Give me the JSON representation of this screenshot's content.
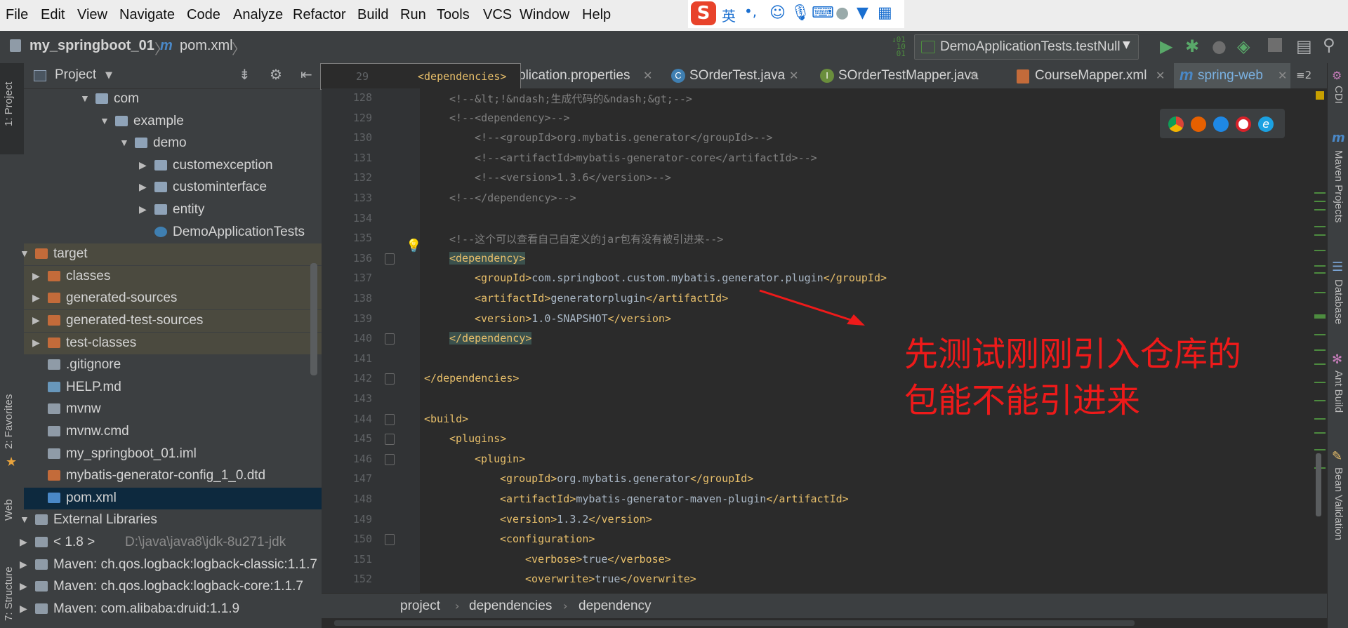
{
  "menu": [
    "File",
    "Edit",
    "View",
    "Navigate",
    "Code",
    "Analyze",
    "Refactor",
    "Build",
    "Run",
    "Tools",
    "VCS",
    "Window",
    "Help"
  ],
  "ime": {
    "logo": "S",
    "lang": "英",
    "punct": "•,"
  },
  "nav": {
    "project": "my_springboot_01",
    "file": "pom.xml",
    "run_config": "DemoApplicationTests.testNull"
  },
  "project_panel": {
    "title": "Project",
    "tree": [
      {
        "label": "com",
        "icon": "package",
        "arrow": "down"
      },
      {
        "label": "example",
        "icon": "package",
        "arrow": "down"
      },
      {
        "label": "demo",
        "icon": "package",
        "arrow": "down"
      },
      {
        "label": "customexception",
        "icon": "package",
        "arrow": "right"
      },
      {
        "label": "custominterface",
        "icon": "package",
        "arrow": "right"
      },
      {
        "label": "entity",
        "icon": "package",
        "arrow": "right"
      },
      {
        "label": "DemoApplicationTests",
        "icon": "class",
        "arrow": ""
      },
      {
        "label": "target",
        "icon": "folder-orange",
        "arrow": "down"
      },
      {
        "label": "classes",
        "icon": "folder-orange",
        "arrow": "right"
      },
      {
        "label": "generated-sources",
        "icon": "folder-orange",
        "arrow": "right"
      },
      {
        "label": "generated-test-sources",
        "icon": "folder-orange",
        "arrow": "right"
      },
      {
        "label": "test-classes",
        "icon": "folder-orange",
        "arrow": "right"
      },
      {
        "label": ".gitignore",
        "icon": "file",
        "arrow": ""
      },
      {
        "label": "HELP.md",
        "icon": "md",
        "arrow": ""
      },
      {
        "label": "mvnw",
        "icon": "file",
        "arrow": ""
      },
      {
        "label": "mvnw.cmd",
        "icon": "file",
        "arrow": ""
      },
      {
        "label": "my_springboot_01.iml",
        "icon": "file",
        "arrow": ""
      },
      {
        "label": "mybatis-generator-config_1_0.dtd",
        "icon": "dtd",
        "arrow": ""
      },
      {
        "label": "pom.xml",
        "icon": "maven",
        "arrow": ""
      },
      {
        "label": "External Libraries",
        "icon": "libs",
        "arrow": "down"
      },
      {
        "label": "< 1.8 >",
        "extra": "D:\\java\\java8\\jdk-8u271-jdk",
        "icon": "jdk",
        "arrow": "right"
      },
      {
        "label": "Maven: ch.qos.logback:logback-classic:1.1.7",
        "icon": "lib",
        "arrow": "right"
      },
      {
        "label": "Maven: ch.qos.logback:logback-core:1.1.7",
        "icon": "lib",
        "arrow": "right"
      },
      {
        "label": "Maven: com.alibaba:druid:1.1.9",
        "icon": "lib",
        "arrow": "right"
      }
    ]
  },
  "tabs": [
    {
      "label": "plication.properties"
    },
    {
      "label": "SOrderTest.java"
    },
    {
      "label": "SOrderTestMapper.java"
    },
    {
      "label": "CourseMapper.xml"
    },
    {
      "label": "spring-web",
      "active": true
    }
  ],
  "tab_overflow": "≡2",
  "pinned": {
    "line": "29",
    "text": "<dependencies>"
  },
  "code_lines": [
    {
      "n": "128",
      "parts": [
        [
          "cm",
          "<!--&lt;!&ndash;生成代码的&ndash;&gt;-->"
        ]
      ],
      "indent": 1
    },
    {
      "n": "129",
      "parts": [
        [
          "cm",
          "<!--<dependency>-->"
        ]
      ],
      "indent": 1
    },
    {
      "n": "130",
      "parts": [
        [
          "cm",
          "<!--<groupId>org.mybatis.generator</groupId>-->"
        ]
      ],
      "indent": 2
    },
    {
      "n": "131",
      "parts": [
        [
          "cm",
          "<!--<artifactId>mybatis-generator-core</artifactId>-->"
        ]
      ],
      "indent": 2
    },
    {
      "n": "132",
      "parts": [
        [
          "cm",
          "<!--<version>1.3.6</version>-->"
        ]
      ],
      "indent": 2
    },
    {
      "n": "133",
      "parts": [
        [
          "cm",
          "<!--</dependency>-->"
        ]
      ],
      "indent": 1
    },
    {
      "n": "134",
      "parts": [],
      "indent": 0
    },
    {
      "n": "135",
      "parts": [
        [
          "cm",
          "<!--这个可以查看自己自定义的jar包有没有被引进来-->"
        ]
      ],
      "indent": 1
    },
    {
      "n": "136",
      "parts": [
        [
          "tg",
          "<dependency>"
        ]
      ],
      "indent": 1
    },
    {
      "n": "137",
      "parts": [
        [
          "tg",
          "<groupId>"
        ],
        [
          "tx",
          "com.springboot.custom.mybatis.generator.plugin"
        ],
        [
          "tg",
          "</groupId>"
        ]
      ],
      "indent": 2
    },
    {
      "n": "138",
      "parts": [
        [
          "tg",
          "<artifactId>"
        ],
        [
          "tx",
          "generatorplugin"
        ],
        [
          "tg",
          "</artifactId>"
        ]
      ],
      "indent": 2
    },
    {
      "n": "139",
      "parts": [
        [
          "tg",
          "<version>"
        ],
        [
          "tx",
          "1.0-SNAPSHOT"
        ],
        [
          "tg",
          "</version>"
        ]
      ],
      "indent": 2
    },
    {
      "n": "140",
      "parts": [
        [
          "tg",
          "</dependency>"
        ]
      ],
      "indent": 1
    },
    {
      "n": "141",
      "parts": [],
      "indent": 0
    },
    {
      "n": "142",
      "parts": [
        [
          "tg",
          "</dependencies>"
        ]
      ],
      "indent": 0
    },
    {
      "n": "143",
      "parts": [],
      "indent": 0
    },
    {
      "n": "144",
      "parts": [
        [
          "tg",
          "<build>"
        ]
      ],
      "indent": 0
    },
    {
      "n": "145",
      "parts": [
        [
          "tg",
          "<plugins>"
        ]
      ],
      "indent": 1
    },
    {
      "n": "146",
      "parts": [
        [
          "tg",
          "<plugin>"
        ]
      ],
      "indent": 2
    },
    {
      "n": "147",
      "parts": [
        [
          "tg",
          "<groupId>"
        ],
        [
          "tx",
          "org.mybatis.generator"
        ],
        [
          "tg",
          "</groupId>"
        ]
      ],
      "indent": 3
    },
    {
      "n": "148",
      "parts": [
        [
          "tg",
          "<artifactId>"
        ],
        [
          "tx",
          "mybatis-generator-maven-plugin"
        ],
        [
          "tg",
          "</artifactId>"
        ]
      ],
      "indent": 3
    },
    {
      "n": "149",
      "parts": [
        [
          "tg",
          "<version>"
        ],
        [
          "tx",
          "1.3.2"
        ],
        [
          "tg",
          "</version>"
        ]
      ],
      "indent": 3
    },
    {
      "n": "150",
      "parts": [
        [
          "tg",
          "<configuration>"
        ]
      ],
      "indent": 3
    },
    {
      "n": "151",
      "parts": [
        [
          "tg",
          "<verbose>"
        ],
        [
          "tx",
          "true"
        ],
        [
          "tg",
          "</verbose>"
        ]
      ],
      "indent": 4
    },
    {
      "n": "152",
      "parts": [
        [
          "tg",
          "<overwrite>"
        ],
        [
          "tx",
          "true"
        ],
        [
          "tg",
          "</overwrite>"
        ]
      ],
      "indent": 4
    }
  ],
  "breadcrumb": [
    "project",
    "dependencies",
    "dependency"
  ],
  "right_tabs": [
    "CDI",
    "Maven Projects",
    "Database",
    "Ant Build",
    "Bean Validation"
  ],
  "left_tabs": [
    "1: Project",
    "2: Favorites",
    "Web",
    "7: Structure"
  ],
  "annotation": [
    "先测试刚刚引入仓库的",
    "包能不能引进来"
  ]
}
